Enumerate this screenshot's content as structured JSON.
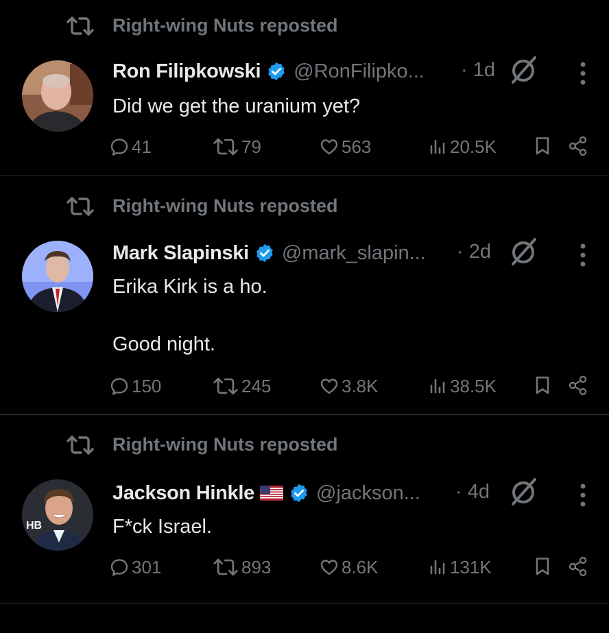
{
  "posts": [
    {
      "reposted_by": "Right-wing Nuts reposted",
      "name": "Ron Filipkowski",
      "flag": "",
      "handle": "@RonFilipko...",
      "time": "· 1d",
      "text": "Did we get the uranium yet?",
      "replies": "41",
      "reposts": "79",
      "likes": "563",
      "views": "20.5K"
    },
    {
      "reposted_by": "Right-wing Nuts reposted",
      "name": "Mark Slapinski",
      "flag": "",
      "handle": "@mark_slapin...",
      "time": "· 2d",
      "text": "Erika Kirk is a ho.\n\nGood night.",
      "replies": "150",
      "reposts": "245",
      "likes": "3.8K",
      "views": "38.5K"
    },
    {
      "reposted_by": "Right-wing Nuts reposted",
      "name": "Jackson Hinkle",
      "flag": "us-flag",
      "handle": "@jackson...",
      "time": "· 4d",
      "text": "F*ck Israel.",
      "avatar_badge": "HB",
      "replies": "301",
      "reposts": "893",
      "likes": "8.6K",
      "views": "131K"
    }
  ],
  "icons": {
    "repost": "repost-icon",
    "verified": "verified-badge-icon",
    "grok": "grok-icon",
    "more": "more-icon",
    "reply": "reply-icon",
    "like": "like-icon",
    "views": "views-icon",
    "bookmark": "bookmark-icon",
    "share": "share-icon"
  },
  "colors": {
    "background": "#000000",
    "text": "#e7e9ea",
    "muted": "#71767b",
    "verified": "#1d9bf0",
    "divider": "#2f3336"
  }
}
